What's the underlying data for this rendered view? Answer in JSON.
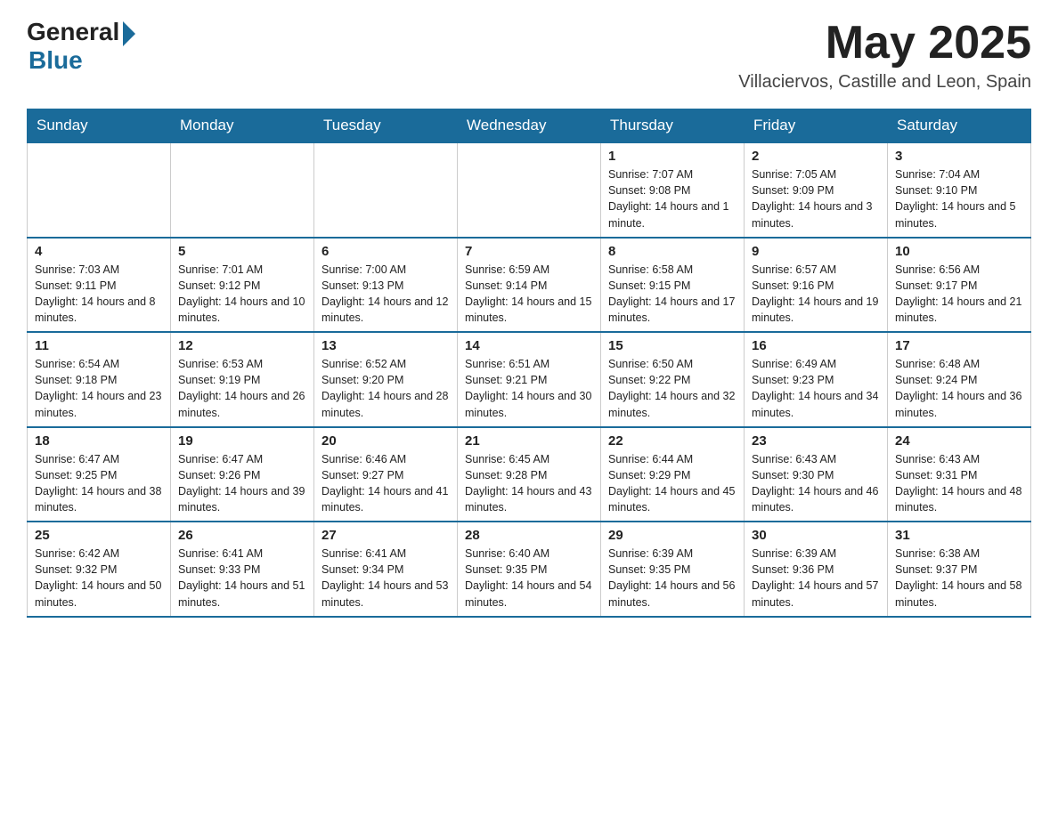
{
  "header": {
    "logo_general": "General",
    "logo_blue": "Blue",
    "month_year": "May 2025",
    "location": "Villaciervos, Castille and Leon, Spain"
  },
  "weekdays": [
    "Sunday",
    "Monday",
    "Tuesday",
    "Wednesday",
    "Thursday",
    "Friday",
    "Saturday"
  ],
  "weeks": [
    [
      {
        "day": "",
        "info": ""
      },
      {
        "day": "",
        "info": ""
      },
      {
        "day": "",
        "info": ""
      },
      {
        "day": "",
        "info": ""
      },
      {
        "day": "1",
        "info": "Sunrise: 7:07 AM\nSunset: 9:08 PM\nDaylight: 14 hours and 1 minute."
      },
      {
        "day": "2",
        "info": "Sunrise: 7:05 AM\nSunset: 9:09 PM\nDaylight: 14 hours and 3 minutes."
      },
      {
        "day": "3",
        "info": "Sunrise: 7:04 AM\nSunset: 9:10 PM\nDaylight: 14 hours and 5 minutes."
      }
    ],
    [
      {
        "day": "4",
        "info": "Sunrise: 7:03 AM\nSunset: 9:11 PM\nDaylight: 14 hours and 8 minutes."
      },
      {
        "day": "5",
        "info": "Sunrise: 7:01 AM\nSunset: 9:12 PM\nDaylight: 14 hours and 10 minutes."
      },
      {
        "day": "6",
        "info": "Sunrise: 7:00 AM\nSunset: 9:13 PM\nDaylight: 14 hours and 12 minutes."
      },
      {
        "day": "7",
        "info": "Sunrise: 6:59 AM\nSunset: 9:14 PM\nDaylight: 14 hours and 15 minutes."
      },
      {
        "day": "8",
        "info": "Sunrise: 6:58 AM\nSunset: 9:15 PM\nDaylight: 14 hours and 17 minutes."
      },
      {
        "day": "9",
        "info": "Sunrise: 6:57 AM\nSunset: 9:16 PM\nDaylight: 14 hours and 19 minutes."
      },
      {
        "day": "10",
        "info": "Sunrise: 6:56 AM\nSunset: 9:17 PM\nDaylight: 14 hours and 21 minutes."
      }
    ],
    [
      {
        "day": "11",
        "info": "Sunrise: 6:54 AM\nSunset: 9:18 PM\nDaylight: 14 hours and 23 minutes."
      },
      {
        "day": "12",
        "info": "Sunrise: 6:53 AM\nSunset: 9:19 PM\nDaylight: 14 hours and 26 minutes."
      },
      {
        "day": "13",
        "info": "Sunrise: 6:52 AM\nSunset: 9:20 PM\nDaylight: 14 hours and 28 minutes."
      },
      {
        "day": "14",
        "info": "Sunrise: 6:51 AM\nSunset: 9:21 PM\nDaylight: 14 hours and 30 minutes."
      },
      {
        "day": "15",
        "info": "Sunrise: 6:50 AM\nSunset: 9:22 PM\nDaylight: 14 hours and 32 minutes."
      },
      {
        "day": "16",
        "info": "Sunrise: 6:49 AM\nSunset: 9:23 PM\nDaylight: 14 hours and 34 minutes."
      },
      {
        "day": "17",
        "info": "Sunrise: 6:48 AM\nSunset: 9:24 PM\nDaylight: 14 hours and 36 minutes."
      }
    ],
    [
      {
        "day": "18",
        "info": "Sunrise: 6:47 AM\nSunset: 9:25 PM\nDaylight: 14 hours and 38 minutes."
      },
      {
        "day": "19",
        "info": "Sunrise: 6:47 AM\nSunset: 9:26 PM\nDaylight: 14 hours and 39 minutes."
      },
      {
        "day": "20",
        "info": "Sunrise: 6:46 AM\nSunset: 9:27 PM\nDaylight: 14 hours and 41 minutes."
      },
      {
        "day": "21",
        "info": "Sunrise: 6:45 AM\nSunset: 9:28 PM\nDaylight: 14 hours and 43 minutes."
      },
      {
        "day": "22",
        "info": "Sunrise: 6:44 AM\nSunset: 9:29 PM\nDaylight: 14 hours and 45 minutes."
      },
      {
        "day": "23",
        "info": "Sunrise: 6:43 AM\nSunset: 9:30 PM\nDaylight: 14 hours and 46 minutes."
      },
      {
        "day": "24",
        "info": "Sunrise: 6:43 AM\nSunset: 9:31 PM\nDaylight: 14 hours and 48 minutes."
      }
    ],
    [
      {
        "day": "25",
        "info": "Sunrise: 6:42 AM\nSunset: 9:32 PM\nDaylight: 14 hours and 50 minutes."
      },
      {
        "day": "26",
        "info": "Sunrise: 6:41 AM\nSunset: 9:33 PM\nDaylight: 14 hours and 51 minutes."
      },
      {
        "day": "27",
        "info": "Sunrise: 6:41 AM\nSunset: 9:34 PM\nDaylight: 14 hours and 53 minutes."
      },
      {
        "day": "28",
        "info": "Sunrise: 6:40 AM\nSunset: 9:35 PM\nDaylight: 14 hours and 54 minutes."
      },
      {
        "day": "29",
        "info": "Sunrise: 6:39 AM\nSunset: 9:35 PM\nDaylight: 14 hours and 56 minutes."
      },
      {
        "day": "30",
        "info": "Sunrise: 6:39 AM\nSunset: 9:36 PM\nDaylight: 14 hours and 57 minutes."
      },
      {
        "day": "31",
        "info": "Sunrise: 6:38 AM\nSunset: 9:37 PM\nDaylight: 14 hours and 58 minutes."
      }
    ]
  ]
}
